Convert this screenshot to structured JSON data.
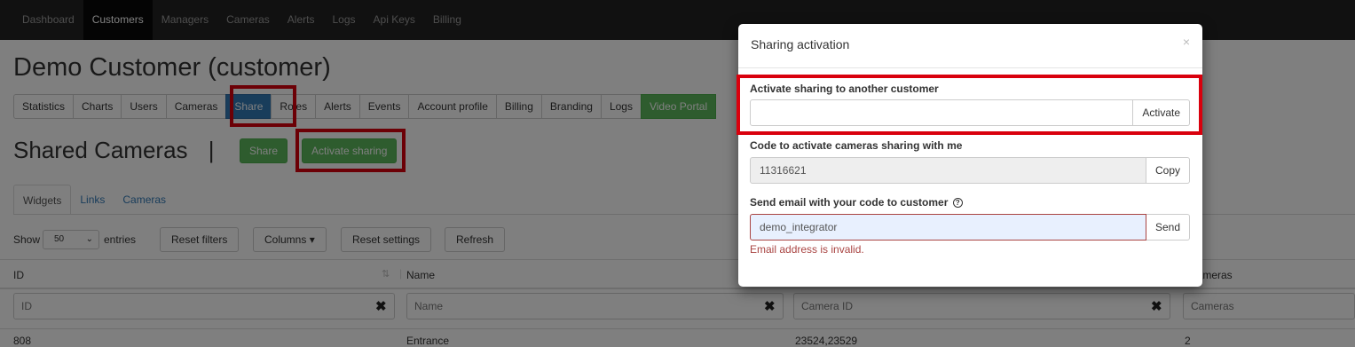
{
  "topnav": {
    "items": [
      "Dashboard",
      "Customers",
      "Managers",
      "Cameras",
      "Alerts",
      "Logs",
      "Api Keys",
      "Billing"
    ]
  },
  "page": {
    "title": "Demo Customer (customer)",
    "subtabs": [
      "Statistics",
      "Charts",
      "Users",
      "Cameras",
      "Share",
      "Roles",
      "Alerts",
      "Events",
      "Account profile",
      "Billing",
      "Branding",
      "Logs",
      "Video Portal"
    ],
    "section_title": "Shared Cameras",
    "separator": "|",
    "share_btn": "Share",
    "activate_sharing_btn": "Activate sharing"
  },
  "tabs": [
    "Widgets",
    "Links",
    "Cameras"
  ],
  "controls": {
    "show_label": "Show",
    "page_size": "50",
    "entries_label": "entries",
    "reset_filters": "Reset filters",
    "columns": "Columns",
    "reset_settings": "Reset settings",
    "refresh": "Refresh"
  },
  "table": {
    "headers": [
      "ID",
      "Name",
      "Cameras"
    ],
    "filter_placeholders": [
      "ID",
      "Name",
      "Camera ID",
      "Cameras"
    ],
    "row": {
      "id": "808",
      "name": "Entrance",
      "camera_ids": "23524,23529",
      "cameras": "2"
    }
  },
  "modal": {
    "title": "Sharing activation",
    "close": "×",
    "activate_label": "Activate sharing to another customer",
    "activate_value": "",
    "activate_btn": "Activate",
    "code_label": "Code to activate cameras sharing with me",
    "code_value": "11316621",
    "copy_btn": "Copy",
    "email_label": "Send email with your code to customer",
    "help_icon_glyph": "?",
    "email_value": "demo_integrator",
    "send_btn": "Send",
    "error": "Email address is invalid."
  },
  "colors": {
    "highlight_red": "#d9000d",
    "primary_blue": "#337ab7",
    "success_green": "#5cb85c",
    "error_red": "#a94442"
  }
}
